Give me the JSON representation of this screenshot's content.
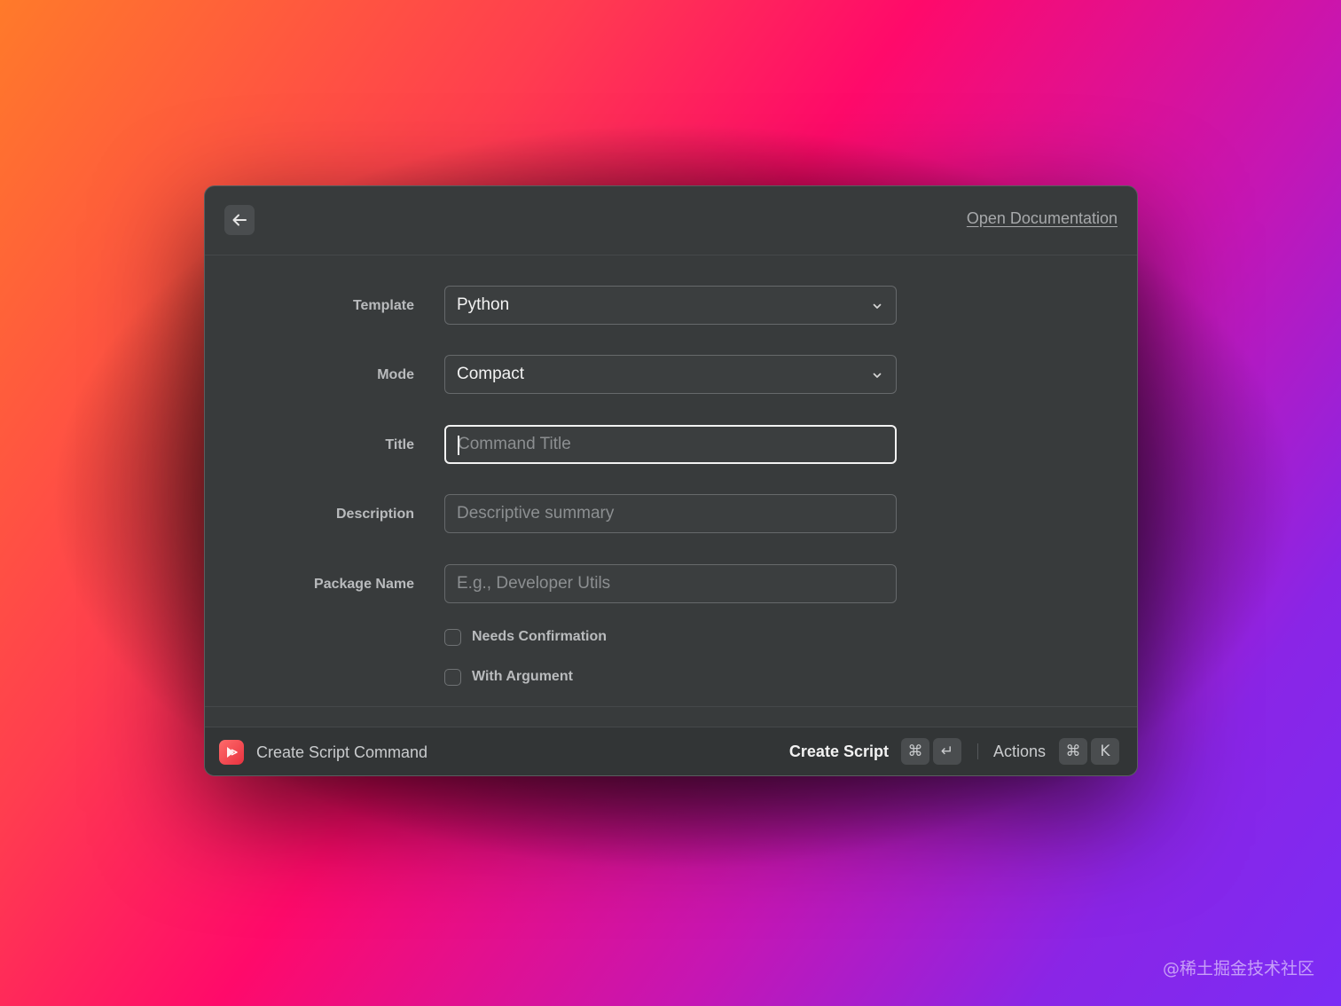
{
  "header": {
    "back_icon": "arrow-left-icon",
    "doc_link": "Open Documentation"
  },
  "form": {
    "template": {
      "label": "Template",
      "value": "Python"
    },
    "mode": {
      "label": "Mode",
      "value": "Compact"
    },
    "title": {
      "label": "Title",
      "value": "",
      "placeholder": "Command Title"
    },
    "description": {
      "label": "Description",
      "value": "",
      "placeholder": "Descriptive summary"
    },
    "package_name": {
      "label": "Package Name",
      "value": "",
      "placeholder": "E.g., Developer Utils"
    },
    "needs_confirmation": {
      "label": "Needs Confirmation",
      "checked": false
    },
    "with_argument": {
      "label": "With Argument",
      "checked": false
    }
  },
  "footer": {
    "app_icon": "script-command-icon",
    "title": "Create Script Command",
    "primary_action": "Create Script",
    "primary_shortcut": [
      "⌘",
      "↵"
    ],
    "secondary_action": "Actions",
    "secondary_shortcut": [
      "⌘",
      "K"
    ]
  },
  "watermark": "@稀土掘金技术社区",
  "colors": {
    "window_bg": "#383b3c",
    "footer_bg": "#323536",
    "app_icon_red": "#e8323f"
  }
}
